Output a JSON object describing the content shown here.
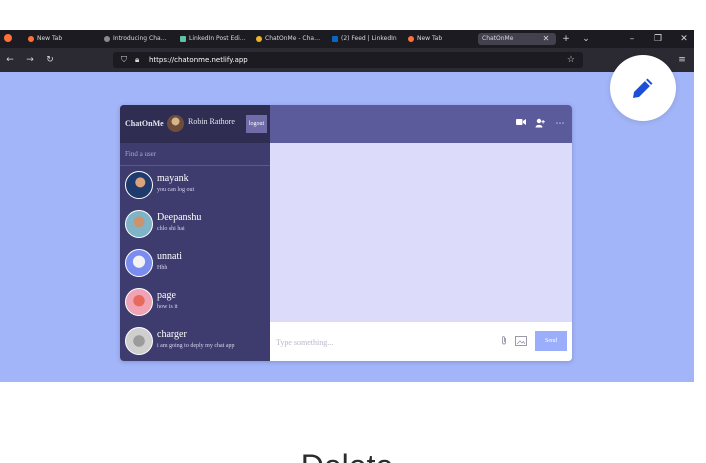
{
  "browser": {
    "tabs": [
      {
        "label": "New Tab",
        "favicon_color": "#ff7139"
      },
      {
        "label": "Introducing Cha…",
        "favicon_color": "#8a8a8a"
      },
      {
        "label": "LinkedIn Post Edi…",
        "favicon_color": "#5fc2a8"
      },
      {
        "label": "ChatOnMe - Cha…",
        "favicon_color": "#f0b429"
      },
      {
        "label": "(2) Feed | LinkedIn",
        "favicon_color": "#0a66c2"
      },
      {
        "label": "New Tab",
        "favicon_color": "#ff7139"
      },
      {
        "label": "ChatOnMe",
        "favicon_color": "",
        "active": true
      }
    ],
    "url": "https://chatonme.netlify.app",
    "icons": {
      "back": "back-arrow-icon",
      "forward": "forward-arrow-icon",
      "reload": "reload-icon",
      "shield": "tracking-shield-icon",
      "lock": "lock-icon",
      "star": "bookmark-star-icon",
      "menu": "hamburger-menu-icon"
    }
  },
  "app": {
    "logo": "ChatOnMe",
    "user_name": "Robin Rathore",
    "logout_label": "logout",
    "search_placeholder": "Find a user",
    "chats": [
      {
        "name": "mayank",
        "last_message": "you can log out",
        "avatar_colors": [
          "#1f3b6e",
          "#d9a37e"
        ]
      },
      {
        "name": "Deepanshu",
        "last_message": "chlo shi hai",
        "avatar_colors": [
          "#7fb3c8",
          "#c9946e"
        ]
      },
      {
        "name": "unnati",
        "last_message": "Hhh",
        "avatar_colors": [
          "#7a8cf0",
          "#f3f3f3"
        ]
      },
      {
        "name": "page",
        "last_message": "how is it",
        "avatar_colors": [
          "#f0a3b5",
          "#e86a5c"
        ]
      },
      {
        "name": "charger",
        "last_message": "i am going to deply my chat app",
        "avatar_colors": [
          "#cfcfcf",
          "#9b9b9b"
        ]
      }
    ],
    "header_icons": [
      "video-camera-icon",
      "add-user-icon",
      "more-dots-icon"
    ],
    "message_placeholder": "Type something...",
    "send_label": "Send",
    "colors": {
      "sidebar": "#3e3c6e",
      "sidebar_header": "#2f2d52",
      "chat_header": "#5b5a9a",
      "messages_bg": "#dcdcfa",
      "send_button": "#9baefb",
      "page_bg": "#a2b5f8"
    }
  },
  "edit_button": {
    "icon": "pencil-icon",
    "color": "#1b4fd6"
  },
  "below_heading": "Delete"
}
